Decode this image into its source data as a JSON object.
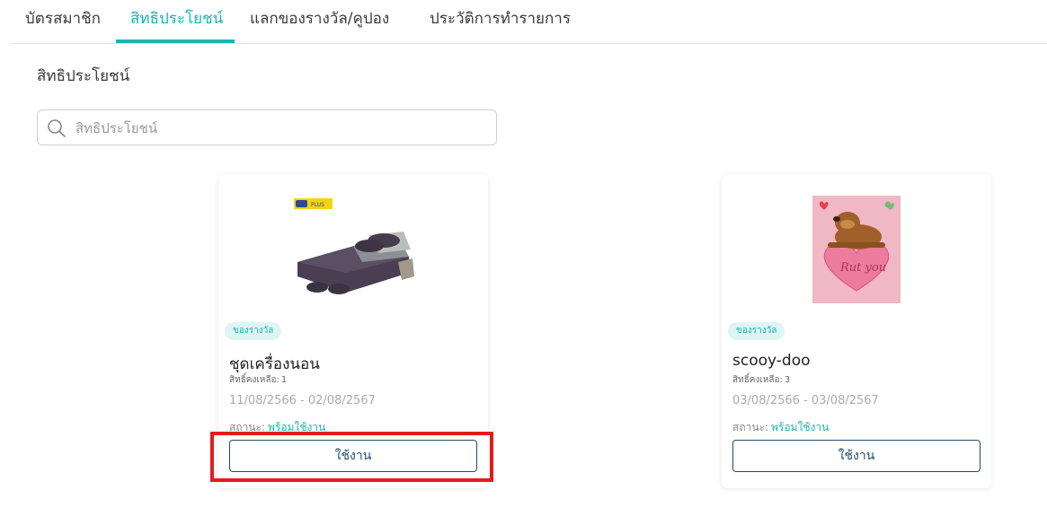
{
  "tabs": [
    {
      "label": "บัตรสมาชิก"
    },
    {
      "label": "สิทธิประโยชน์"
    },
    {
      "label": "แลกของรางวัล/คูปอง"
    },
    {
      "label": "ประวัติการทำรายการ"
    }
  ],
  "active_tab": "สิทธิประโยชน์",
  "accent_color": "#1ab5b3",
  "page_title": "สิทธิประโยชน์",
  "search": {
    "placeholder": "สิทธิประโยชน์",
    "value": ""
  },
  "cards": [
    {
      "badge": "ของรางวัล",
      "name": "ชุดเครื่องนอน",
      "remaining_label": "สิทธิ์คงเหลือ:",
      "remaining_value": "1",
      "dates": "11/08/2566 - 02/08/2567",
      "status_label": "สถานะ:",
      "status_value": "พร้อมใช้งาน",
      "button": "ใช้งาน",
      "image": "bedding-set-image",
      "logo_text": "PLUS"
    },
    {
      "badge": "ของรางวัล",
      "name": "scooy-doo",
      "remaining_label": "สิทธิ์คงเหลือ:",
      "remaining_value": "3",
      "dates": "03/08/2566 - 03/08/2567",
      "status_label": "สถานะ:",
      "status_value": "พร้อมใช้งาน",
      "button": "ใช้งาน",
      "image": "scooby-doo-card-image",
      "image_text": "Rut you"
    }
  ],
  "highlight_color": "#e21c1c"
}
